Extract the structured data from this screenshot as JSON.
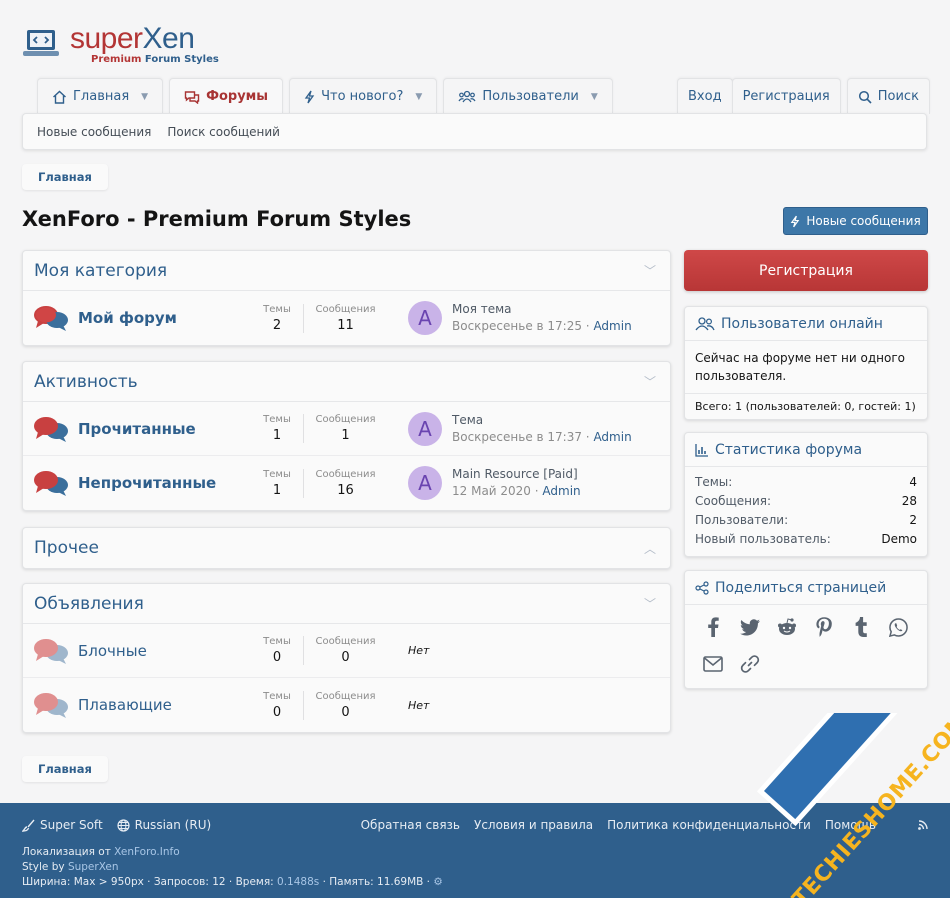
{
  "logo": {
    "part1": "super",
    "part2": "Xen",
    "sub1": "Premium",
    "sub2": "Forum Styles"
  },
  "nav": {
    "tabs": [
      {
        "label": "Главная",
        "icon": "home-icon",
        "caret": true
      },
      {
        "label": "Форумы",
        "icon": "comments-icon",
        "caret": false,
        "active": true
      },
      {
        "label": "Что нового?",
        "icon": "bolt-icon",
        "caret": true
      },
      {
        "label": "Пользователи",
        "icon": "users-icon",
        "caret": true
      }
    ],
    "login": "Вход",
    "register": "Регистрация",
    "search": "Поиск"
  },
  "subnav": {
    "items": [
      "Новые сообщения",
      "Поиск сообщений"
    ]
  },
  "breadcrumb": {
    "home": "Главная"
  },
  "page": {
    "title": "XenForo - Premium Forum Styles",
    "new_posts_button": "Новые сообщения"
  },
  "labels": {
    "threads": "Темы",
    "messages": "Сообщения",
    "none": "Нет"
  },
  "categories": [
    {
      "title": "Моя категория",
      "chevron": "down",
      "forums": [
        {
          "title": "Мой форум",
          "threads": "2",
          "messages": "11",
          "avatar": "A",
          "last_title": "Моя тема",
          "last_date": "Воскресенье в 17:25",
          "last_user": "Admin"
        }
      ]
    },
    {
      "title": "Активность",
      "chevron": "down",
      "forums": [
        {
          "title": "Прочитанные",
          "threads": "1",
          "messages": "1",
          "avatar": "A",
          "last_title": "Тема",
          "last_date": "Воскресенье в 17:37",
          "last_user": "Admin"
        },
        {
          "title": "Непрочитанные",
          "threads": "1",
          "messages": "16",
          "avatar": "A",
          "last_title": "Main Resource [Paid]",
          "last_date": "12 Май 2020",
          "last_user": "Admin"
        }
      ]
    },
    {
      "title": "Прочее",
      "chevron": "up",
      "forums": []
    },
    {
      "title": "Объявления",
      "chevron": "down",
      "forums": [
        {
          "title": "Блочные",
          "threads": "0",
          "messages": "0"
        },
        {
          "title": "Плавающие",
          "threads": "0",
          "messages": "0"
        }
      ]
    }
  ],
  "sidebar": {
    "register": "Регистрация",
    "online": {
      "title": "Пользователи онлайн",
      "text": "Сейчас на форуме нет ни одного пользователя.",
      "footer": "Всего: 1 (пользователей: 0, гостей: 1)"
    },
    "stats": {
      "title": "Статистика форума",
      "rows": [
        {
          "label": "Темы:",
          "value": "4"
        },
        {
          "label": "Сообщения:",
          "value": "28"
        },
        {
          "label": "Пользователи:",
          "value": "2"
        },
        {
          "label": "Новый пользователь:",
          "value": "Demo"
        }
      ]
    },
    "share": {
      "title": "Поделиться страницей",
      "icons": [
        "facebook-icon",
        "twitter-icon",
        "reddit-icon",
        "pinterest-icon",
        "tumblr-icon",
        "whatsapp-icon",
        "email-icon",
        "link-icon"
      ]
    }
  },
  "footer": {
    "style_chooser": "Super Soft",
    "language": "Russian (RU)",
    "links": [
      "Обратная связь",
      "Условия и правила",
      "Политика конфиденциальности",
      "Помощь"
    ],
    "loc_prefix": "Локализация от ",
    "loc_link": "XenForo.Info",
    "style_prefix": "Style by ",
    "style_link": "SuperXen",
    "debug_a": "Ширина: Max > 950px · Запросов: 12 · Время: ",
    "debug_time": "0.1488s",
    "debug_b": " · Память: 11.69MB · "
  },
  "watermark": "TECHIESHOME.COM",
  "colors": {
    "brand_blue": "#2f5f8c",
    "accent_red": "#b83636",
    "avatar_bg": "#c9b3e8"
  }
}
